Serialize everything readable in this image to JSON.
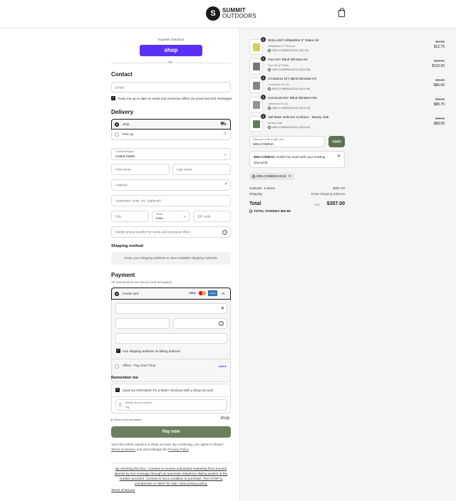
{
  "header": {
    "brand_line1": "SUMMIT",
    "brand_line2": "OUTDOORS",
    "logo_mark": "S",
    "cart_icon": "shopping-bag-icon"
  },
  "express": {
    "label": "Express checkout",
    "shop_button": "shop",
    "or": "OR"
  },
  "contact": {
    "heading": "Contact",
    "email_placeholder": "Email",
    "newsletter_label": "Keep me up to date on news and exclusive offers via email and text messages"
  },
  "delivery": {
    "heading": "Delivery",
    "ship": "Ship",
    "pickup": "Pick up",
    "country_label": "Country/Region",
    "country_value": "United States",
    "first_name": "First name",
    "last_name": "Last name",
    "address": "Address",
    "apartment": "Apartment, suite, etc. (optional)",
    "city": "City",
    "state_label": "State",
    "state_value": "Iowa",
    "zip": "ZIP code",
    "phone": "Mobile phone number for news and exclusive offers"
  },
  "shipping_method": {
    "heading": "Shipping method",
    "notice": "Enter your shipping address to view available shipping methods."
  },
  "payment": {
    "heading": "Payment",
    "subtitle": "All transactions are secure and encrypted.",
    "credit_card": "Credit card",
    "more_cards": "+5",
    "card_brands": [
      "VISA",
      "MC",
      "AMEX"
    ],
    "billing_same": "Use shipping address as billing address",
    "affirm": "Affirm - Pay Over Time",
    "affirm_logo": "affirm"
  },
  "remember": {
    "heading": "Remember me",
    "save_label": "Save my information for a faster checkout with a Shop account",
    "phone_label": "Mobile phone number",
    "phone_prefix": "+1",
    "secure": "Secure and encrypted",
    "shop_logo": "shop"
  },
  "pay_button": "Pay now",
  "consent_text_1": "Your info will be saved to a Shop account. By continuing, you agree to Shop's",
  "consent_terms": "Terms of Service",
  "consent_and": "and acknowledge the",
  "consent_privacy": "Privacy Policy",
  "sms_consent": [
    "By checking this box, I consent to receive automated marketing from Summit",
    "Brands by text message through an automatic telephone dialing system at the",
    "number provided. Consent is not a condition to purchase. Text STOP to",
    "unsubscribe or HELP for help. View privacy policy."
  ],
  "footer_terms": "Terms of service",
  "items": [
    {
      "qty": "1",
      "name": "SlotLock® Inflatables 9\" Stake Kit",
      "variant": "Inflatables 9\" Sleeves",
      "discount": "WELCOMEBACK15 (-$2.24)",
      "compare": "$14.99",
      "price": "$12.75"
    },
    {
      "qty": "1",
      "name": "Gun DIY Blind Window Kit",
      "variant": "Gun Kit (2 Pack)",
      "discount": "WELCOMEBACK15 (-$19.49)",
      "compare": "$129.99",
      "price": "$110.50"
    },
    {
      "qty": "1",
      "name": "Crossbow DIY Blind Window Kit",
      "variant": "Crossbow Kit (1)",
      "discount": "WELCOMEBACK15 (-$14.99)",
      "compare": "$99.99",
      "price": "$85.00"
    },
    {
      "qty": "1",
      "name": "Universal DIY Blind Window Kits",
      "variant": "Universal Kit (1)",
      "discount": "WELCOMEBACK15 (-$14.24)",
      "compare": "$94.99",
      "price": "$80.75"
    },
    {
      "qty": "1",
      "name": "Tail Mate GelCore Cushion - Mossy Oak",
      "variant": "Mossy Oak",
      "discount": "WELCOMEBACK15 (-$11.99)",
      "compare": "$79.99",
      "price": "$68.00"
    }
  ],
  "discount": {
    "label": "Discount code or gift card",
    "value": "WELCOME10",
    "apply": "Apply",
    "error_code": "WELCOME10",
    "error_rest": "couldn't be used with your existing",
    "error_line2": "discounts.",
    "applied_tag": "WELCOMEBACK15"
  },
  "summary": {
    "subtotal_label": "Subtotal · 5 items",
    "subtotal": "$357.00",
    "shipping_label": "Shipping",
    "shipping_value": "Enter shipping address",
    "total_label": "Total",
    "currency": "USD",
    "total": "$357.00",
    "savings_label": "TOTAL SAVINGS",
    "savings": "$62.95"
  },
  "colors": {
    "shop_purple": "#5a31f4",
    "pay_green": "#6b7f5e",
    "apply_green": "#5f7350"
  }
}
